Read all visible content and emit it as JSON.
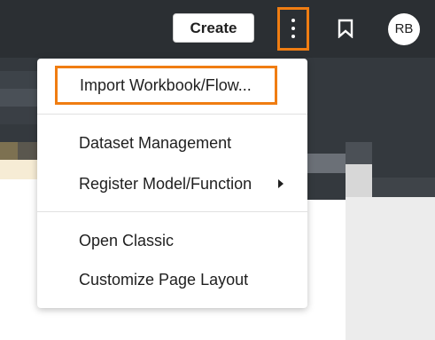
{
  "header": {
    "create_label": "Create",
    "kebab_icon": "more-vertical-icon",
    "bookmark_icon": "bookmark-icon",
    "avatar_initials": "RB",
    "accent_color": "#f07d12"
  },
  "menu": {
    "items": [
      {
        "label": "Import Workbook/Flow...",
        "highlighted": true
      },
      {
        "label": "Dataset Management"
      },
      {
        "label": "Register Model/Function",
        "has_submenu": true
      },
      {
        "label": "Open Classic"
      },
      {
        "label": "Customize Page Layout"
      }
    ]
  }
}
